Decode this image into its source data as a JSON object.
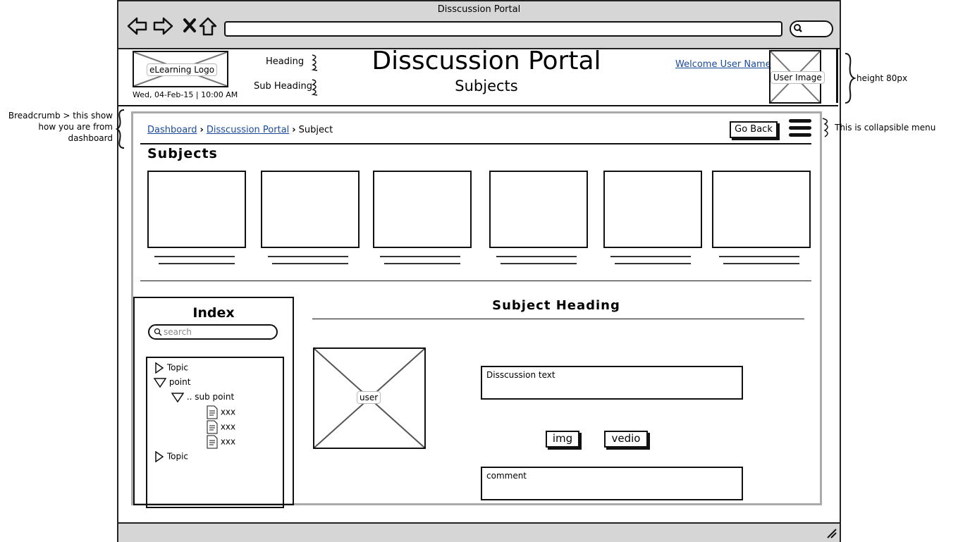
{
  "window": {
    "title": "Disscussion Portal"
  },
  "toolbar": {
    "icons": [
      "back-arrow-icon",
      "forward-arrow-icon",
      "close-icon",
      "home-icon",
      "search-icon"
    ]
  },
  "header": {
    "logo_label": "eLearning Logo",
    "date": "Wed, 04-Feb-15 | 10:00 AM",
    "heading_label": "Heading",
    "subheading_label": "Sub Heading",
    "title": "Disscussion Portal",
    "subtitle": "Subjects",
    "welcome": "Welcome User Name",
    "user_image_label": "User Image"
  },
  "annotations": {
    "height": "height 80px",
    "breadcrumb": [
      "Breadcrumb > this show",
      "how you are from",
      "dashboard"
    ],
    "menu": "This is collapsible menu"
  },
  "breadcrumb": {
    "items": [
      "Dashboard",
      "Disscussion Portal"
    ],
    "current": "Subject"
  },
  "go_back": "Go Back",
  "subjects": {
    "title": "Subjects",
    "count": 6
  },
  "index": {
    "title": "Index",
    "search_placeholder": "search",
    "tree": [
      {
        "label": "Topic",
        "type": "collapsed"
      },
      {
        "label": "point",
        "type": "expanded"
      },
      {
        "label": ".. sub point",
        "type": "expanded"
      },
      {
        "label": "xxx",
        "type": "file"
      },
      {
        "label": "xxx",
        "type": "file"
      },
      {
        "label": "xxx",
        "type": "file"
      },
      {
        "label": "Topic",
        "type": "collapsed"
      }
    ]
  },
  "main": {
    "subject_heading": "Subject Heading",
    "user_label": "user",
    "discussion_text": "Disscussion text",
    "img_button": "img",
    "video_button": "vedio",
    "comment_label": "comment"
  }
}
